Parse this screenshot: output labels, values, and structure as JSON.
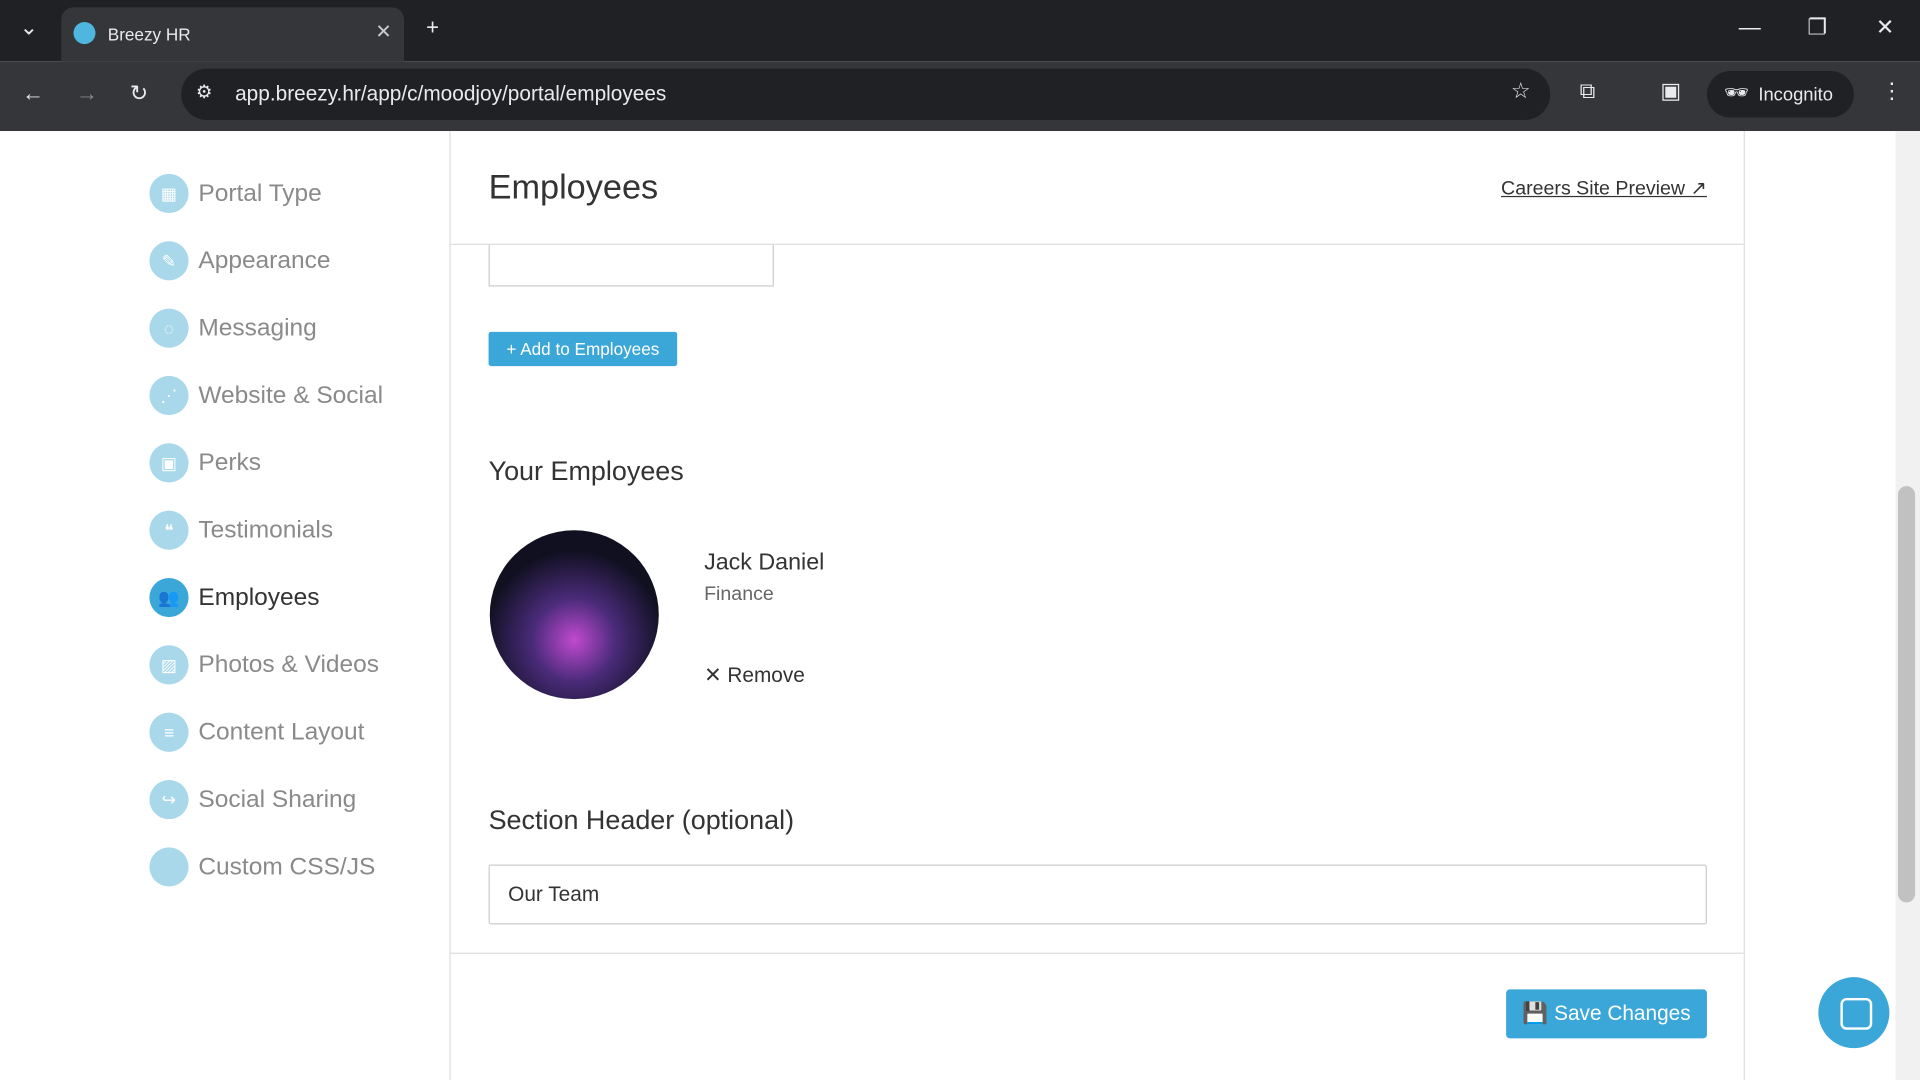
{
  "browser": {
    "tab_title": "Breezy HR",
    "url": "app.breezy.hr/app/c/moodjoy/portal/employees",
    "incognito_label": "Incognito"
  },
  "sidebar": {
    "items": [
      {
        "label": "Portal Type",
        "icon": "grid-icon"
      },
      {
        "label": "Appearance",
        "icon": "brush-icon"
      },
      {
        "label": "Messaging",
        "icon": "chat-icon"
      },
      {
        "label": "Website & Social",
        "icon": "share-icon"
      },
      {
        "label": "Perks",
        "icon": "gift-icon"
      },
      {
        "label": "Testimonials",
        "icon": "comments-icon"
      },
      {
        "label": "Employees",
        "icon": "users-icon",
        "active": true
      },
      {
        "label": "Photos & Videos",
        "icon": "image-icon"
      },
      {
        "label": "Content Layout",
        "icon": "list-icon"
      },
      {
        "label": "Social Sharing",
        "icon": "share-arrow-icon"
      },
      {
        "label": "Custom CSS/JS",
        "icon": "code-icon"
      }
    ]
  },
  "main": {
    "title": "Employees",
    "preview_link": "Careers Site Preview",
    "add_button": "+ Add to Employees",
    "your_employees": "Your Employees",
    "employees": [
      {
        "name": "Jack Daniel",
        "department": "Finance",
        "remove": "Remove"
      }
    ],
    "section_header_label": "Section Header (optional)",
    "section_header_value": "Our Team",
    "save_button": "Save Changes"
  },
  "colors": {
    "accent": "#3ba7d9"
  }
}
